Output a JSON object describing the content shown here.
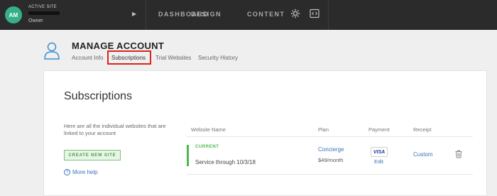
{
  "topbar": {
    "avatar_initials": "AM",
    "site_label": "ACTIVE SITE",
    "site_role": "Owner",
    "nav": [
      "DASHBOARD",
      "DESIGN",
      "CONTENT"
    ],
    "icons": [
      "play-icon",
      "gear-icon",
      "code-icon"
    ]
  },
  "header": {
    "title": "MANAGE ACCOUNT",
    "tabs": [
      "Account Info",
      "Subscriptions",
      "Trial Websites",
      "Security History"
    ],
    "active_tab": "Subscriptions",
    "highlight_color": "#d9251d"
  },
  "subscriptions": {
    "title": "Subscriptions",
    "description": "Here are all the individual websites that are linked to your account",
    "create_button": "CREATE NEW SITE",
    "help_link": "More help",
    "columns": [
      "Website Name",
      "Plan",
      "Payment",
      "Receipt"
    ],
    "row": {
      "status": "CURRENT",
      "service": "Service through 10/3/18",
      "plan": "Concierge",
      "price": "$49/month",
      "card_brand": "VISA",
      "payment_action": "Edit",
      "receipt": "Custom"
    }
  },
  "colors": {
    "topbar": "#2b2b2b",
    "accent_green": "#4cb84a",
    "link_blue": "#3d73b8"
  }
}
